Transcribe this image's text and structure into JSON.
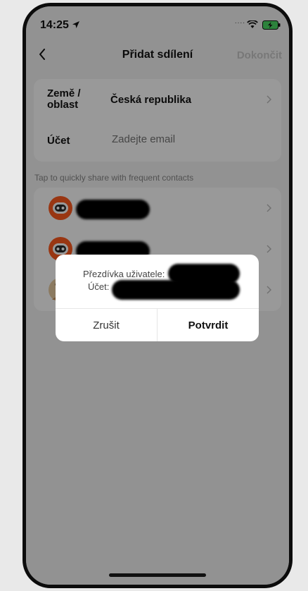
{
  "status_bar": {
    "time": "14:25",
    "signal_dots": "....",
    "location_icon": "location-arrow-icon",
    "wifi_icon": "wifi-icon",
    "battery_icon": "battery-charging-icon",
    "battery_color": "#4cd964"
  },
  "nav": {
    "title": "Přidat sdílení",
    "done_label": "Dokončit",
    "back_icon": "chevron-left-icon"
  },
  "form": {
    "region_label": "Země / oblast",
    "region_value": "Česká republika",
    "account_label": "Účet",
    "account_placeholder": "Zadejte email"
  },
  "hint": "Tap to quickly share with frequent contacts",
  "contacts": [
    {
      "avatar": "robot-avatar-icon"
    },
    {
      "avatar": "robot-avatar-icon"
    },
    {
      "avatar": "person-avatar-icon"
    }
  ],
  "dialog": {
    "nickname_label": "Přezdívka uživatele:",
    "account_label": "Účet:",
    "cancel_label": "Zrušit",
    "confirm_label": "Potvrdit"
  },
  "colors": {
    "accent_orange": "#ff5a1f",
    "overlay": "rgba(0,0,0,0.4)"
  }
}
